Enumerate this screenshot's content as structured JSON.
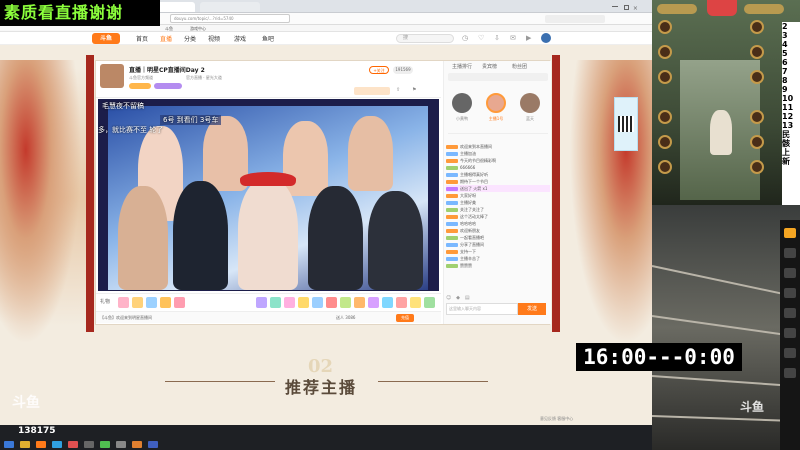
{
  "overlay": {
    "banner": "素质看直播谢谢",
    "clock": "16:00---0:00",
    "counter": "138175",
    "numbers": [
      "2",
      "3",
      "4",
      "5",
      "6",
      "7",
      "8",
      "9",
      "10",
      "11",
      "12",
      "13"
    ],
    "side_texts": [
      "民",
      "骸",
      "上",
      "新"
    ],
    "watermark": "斗鱼"
  },
  "browser": {
    "url": "douyu.com/topic/...?rid=5740",
    "bookmarks": [
      "斗鱼",
      "游戏中心"
    ],
    "nav": {
      "logo": "斗鱼",
      "items": [
        "首页",
        "直播",
        "分类",
        "视频",
        "游戏",
        "鱼吧"
      ],
      "search_placeholder": "搜"
    }
  },
  "room": {
    "title": "直播｜明星CP直播间Day 2",
    "host_meta": "斗鱼官方频道",
    "meta_tags": "官方直播 · 星光大道",
    "follow": "+关注",
    "fans": "191569",
    "video_overlays": [
      "毛慧夜不留稿",
      "6号 到看们 3号车",
      "多，就比赛不至 轮了"
    ],
    "gift_bar_label": "礼物",
    "bottom_text": "【斗鱼】欢迎来到明星直播间",
    "bottom_right": "送人 3086",
    "recharge_btn": "充值"
  },
  "side": {
    "tabs": [
      "主播排行",
      "贵宾榜",
      "粉丝团"
    ],
    "ranks": [
      "小黄鸭",
      "主播1号",
      "蓝天"
    ],
    "chat": [
      "欢迎来到本直播间",
      "主播加油",
      "今天的节目很精彩啊",
      "666666",
      "主播唱得真好听",
      "期待下一个节目",
      "送出了 火箭 x1",
      "大家好呀",
      "主播好美",
      "关注了关注了",
      "这个活动太棒了",
      "哈哈哈哈",
      "欢迎新朋友",
      "一起看直播吧",
      "分享了直播间",
      "支持一下",
      "主播辛苦了",
      "赞赞赞"
    ],
    "chat_placeholder": "这里输入聊天内容",
    "send": "发送"
  },
  "recommend": {
    "number": "02",
    "title": "推荐主播"
  },
  "feedback": "意见反馈  客服中心",
  "colors": {
    "accent": "#ff7a1a",
    "pillar": "#a6281e",
    "banner_text": "#8cff3c"
  }
}
